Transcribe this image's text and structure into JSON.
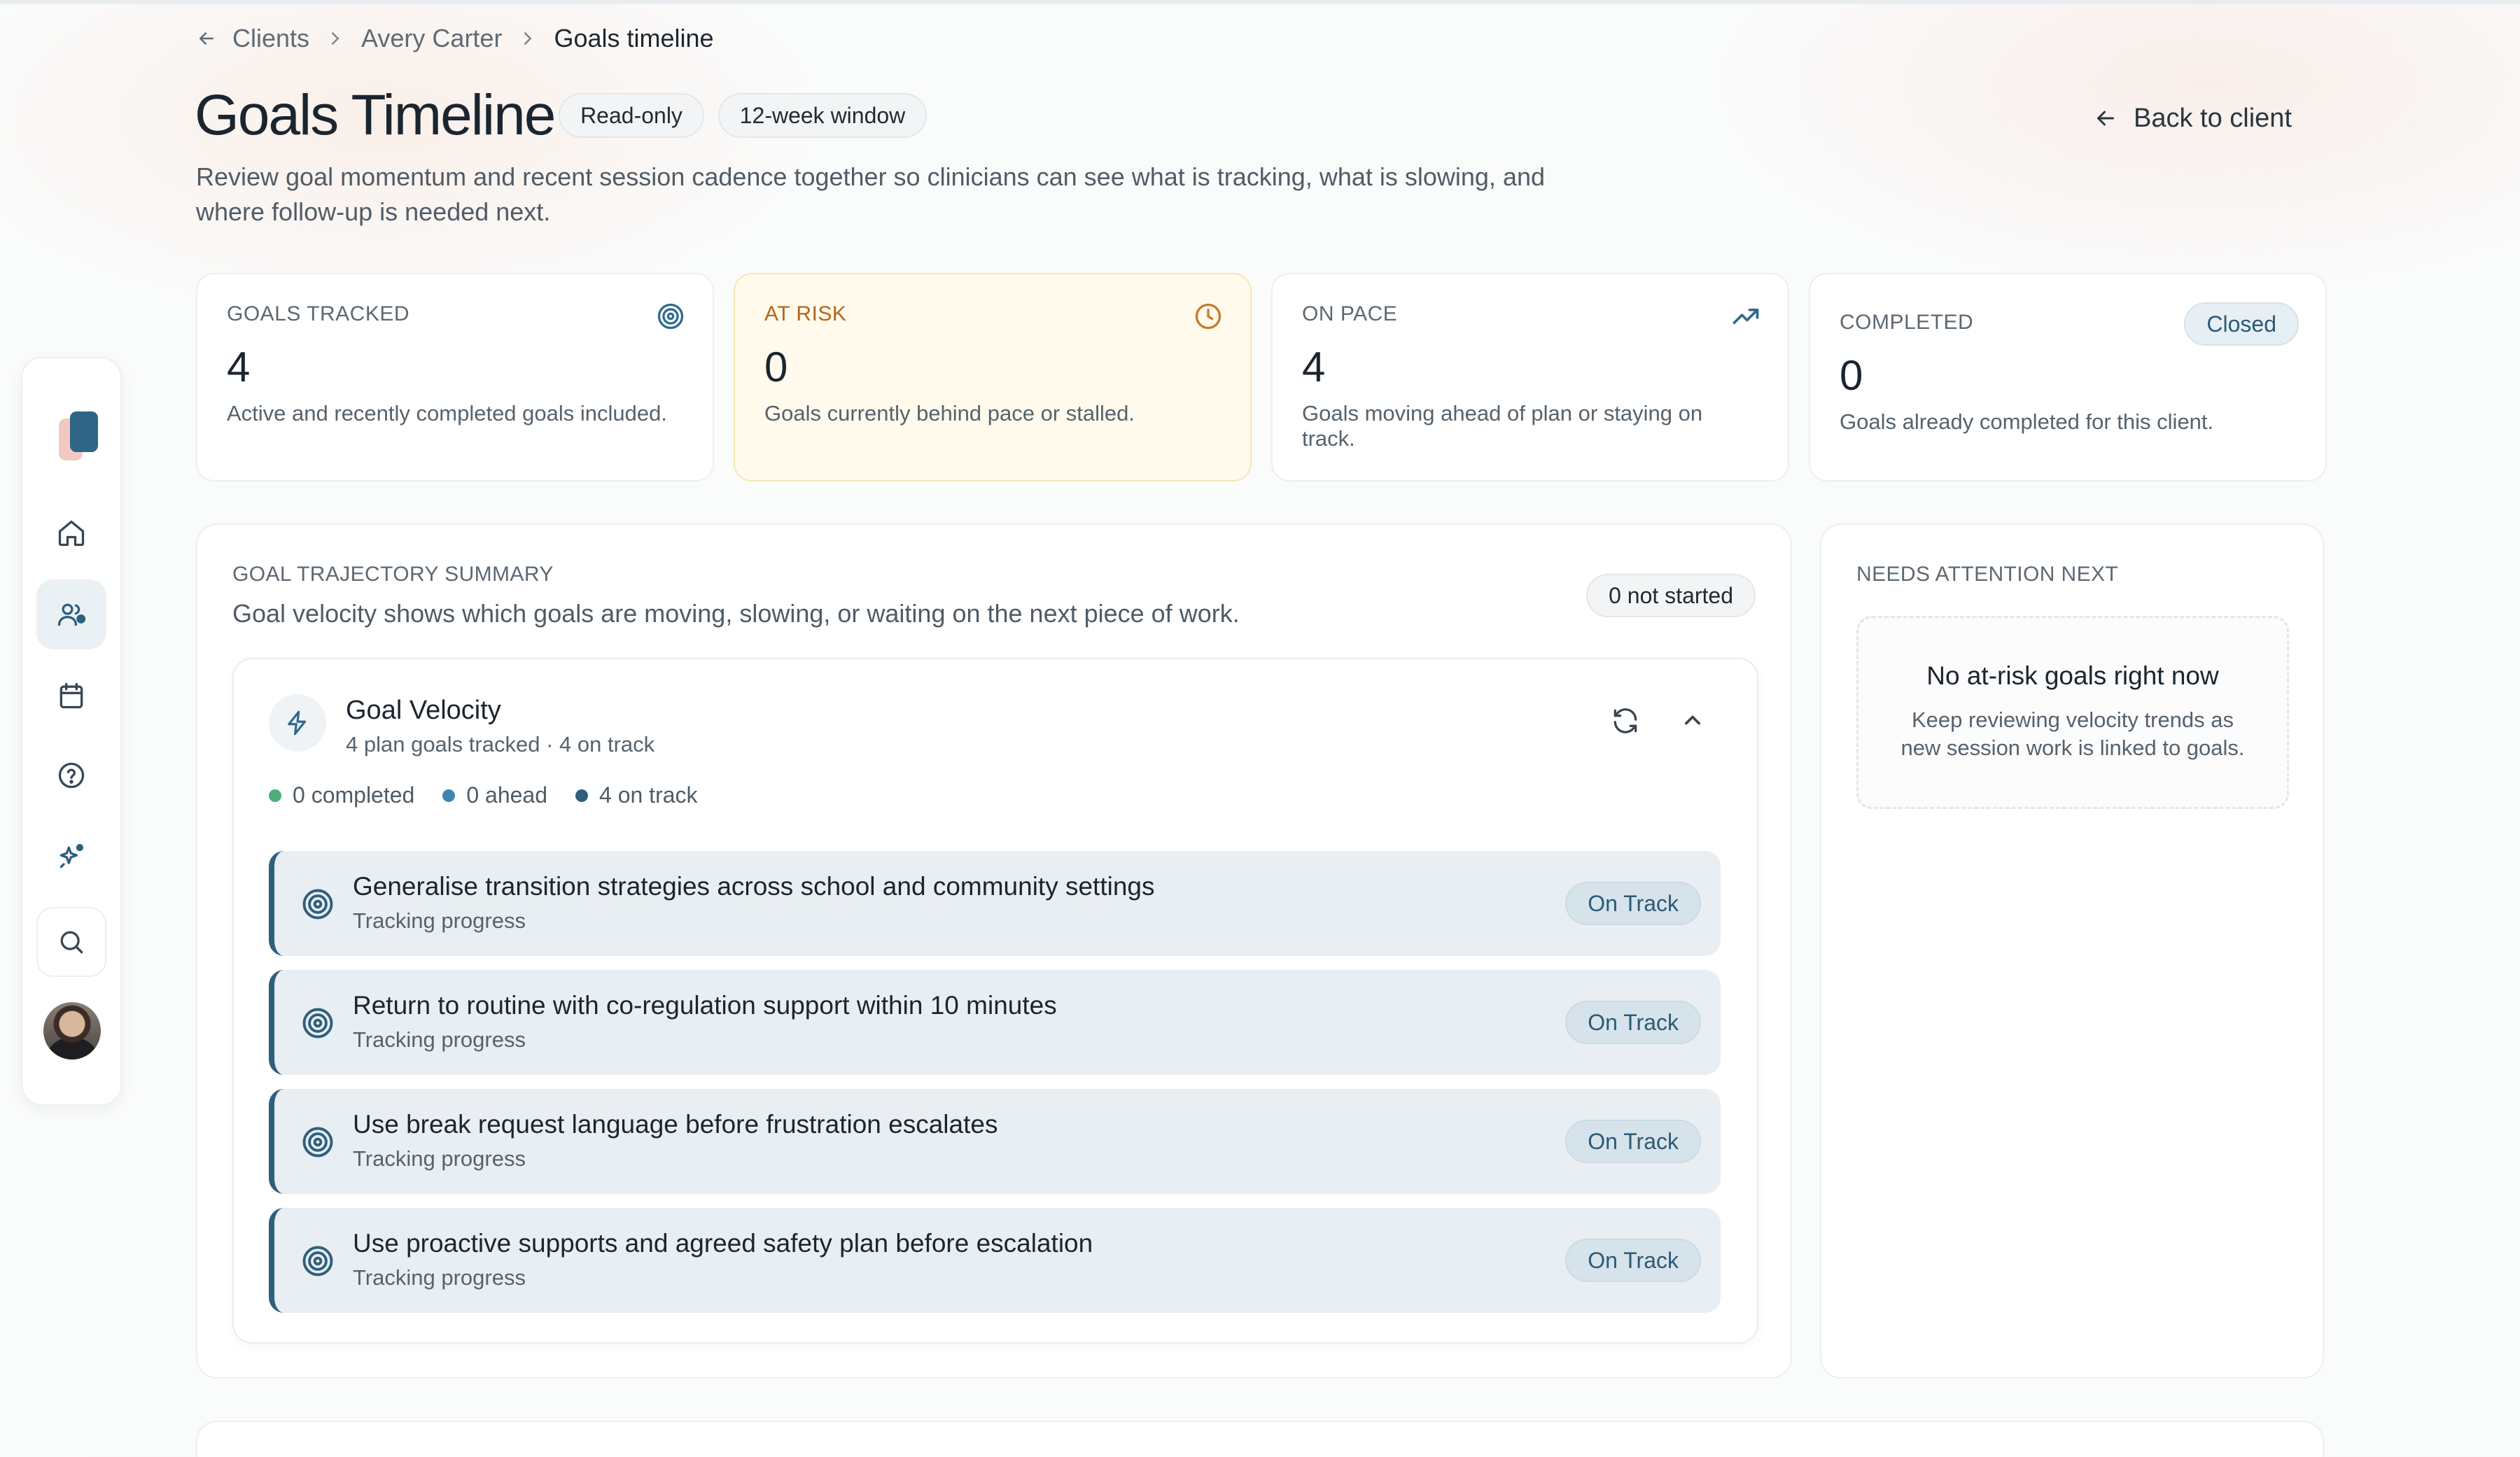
{
  "breadcrumb": {
    "items": [
      "Clients",
      "Avery Carter",
      "Goals timeline"
    ]
  },
  "header": {
    "title": "Goals Timeline",
    "chips": [
      "Read-only",
      "12-week window"
    ],
    "back_label": "Back to client",
    "subtitle": "Review goal momentum and recent session cadence together so clinicians can see what is tracking, what is slowing, and where follow-up is needed next."
  },
  "stats": [
    {
      "label": "GOALS TRACKED",
      "value": "4",
      "desc": "Active and recently completed goals included.",
      "icon": "target-icon"
    },
    {
      "label": "AT RISK",
      "value": "0",
      "desc": "Goals currently behind pace or stalled.",
      "icon": "clock-icon"
    },
    {
      "label": "ON PACE",
      "value": "4",
      "desc": "Goals moving ahead of plan or staying on track.",
      "icon": "trending-up-icon"
    },
    {
      "label": "COMPLETED",
      "value": "0",
      "desc": "Goals already completed for this client.",
      "badge": "Closed"
    }
  ],
  "summary": {
    "label": "GOAL TRAJECTORY SUMMARY",
    "subtitle": "Goal velocity shows which goals are moving, slowing, or waiting on the next piece of work.",
    "not_started": "0 not started"
  },
  "velocity": {
    "title": "Goal Velocity",
    "subtitle": "4 plan goals tracked · 4 on track",
    "legend": [
      {
        "label": "0 completed",
        "color": "#4caf7a"
      },
      {
        "label": "0 ahead",
        "color": "#3e86b2"
      },
      {
        "label": "4 on track",
        "color": "#2f5f7d"
      }
    ],
    "goals": [
      {
        "title": "Generalise transition strategies across school and community settings",
        "sub": "Tracking progress",
        "status": "On Track"
      },
      {
        "title": "Return to routine with co-regulation support within 10 minutes",
        "sub": "Tracking progress",
        "status": "On Track"
      },
      {
        "title": "Use break request language before frustration escalates",
        "sub": "Tracking progress",
        "status": "On Track"
      },
      {
        "title": "Use proactive supports and agreed safety plan before escalation",
        "sub": "Tracking progress",
        "status": "On Track"
      }
    ]
  },
  "attention": {
    "label": "NEEDS ATTENTION NEXT",
    "empty_title": "No at-risk goals right now",
    "empty_desc": "Keep reviewing velocity trends as new session work is linked to goals."
  },
  "colors": {
    "accent": "#2f5f7d",
    "risk_bg": "#fffaeb",
    "risk_text": "#b5651d"
  }
}
